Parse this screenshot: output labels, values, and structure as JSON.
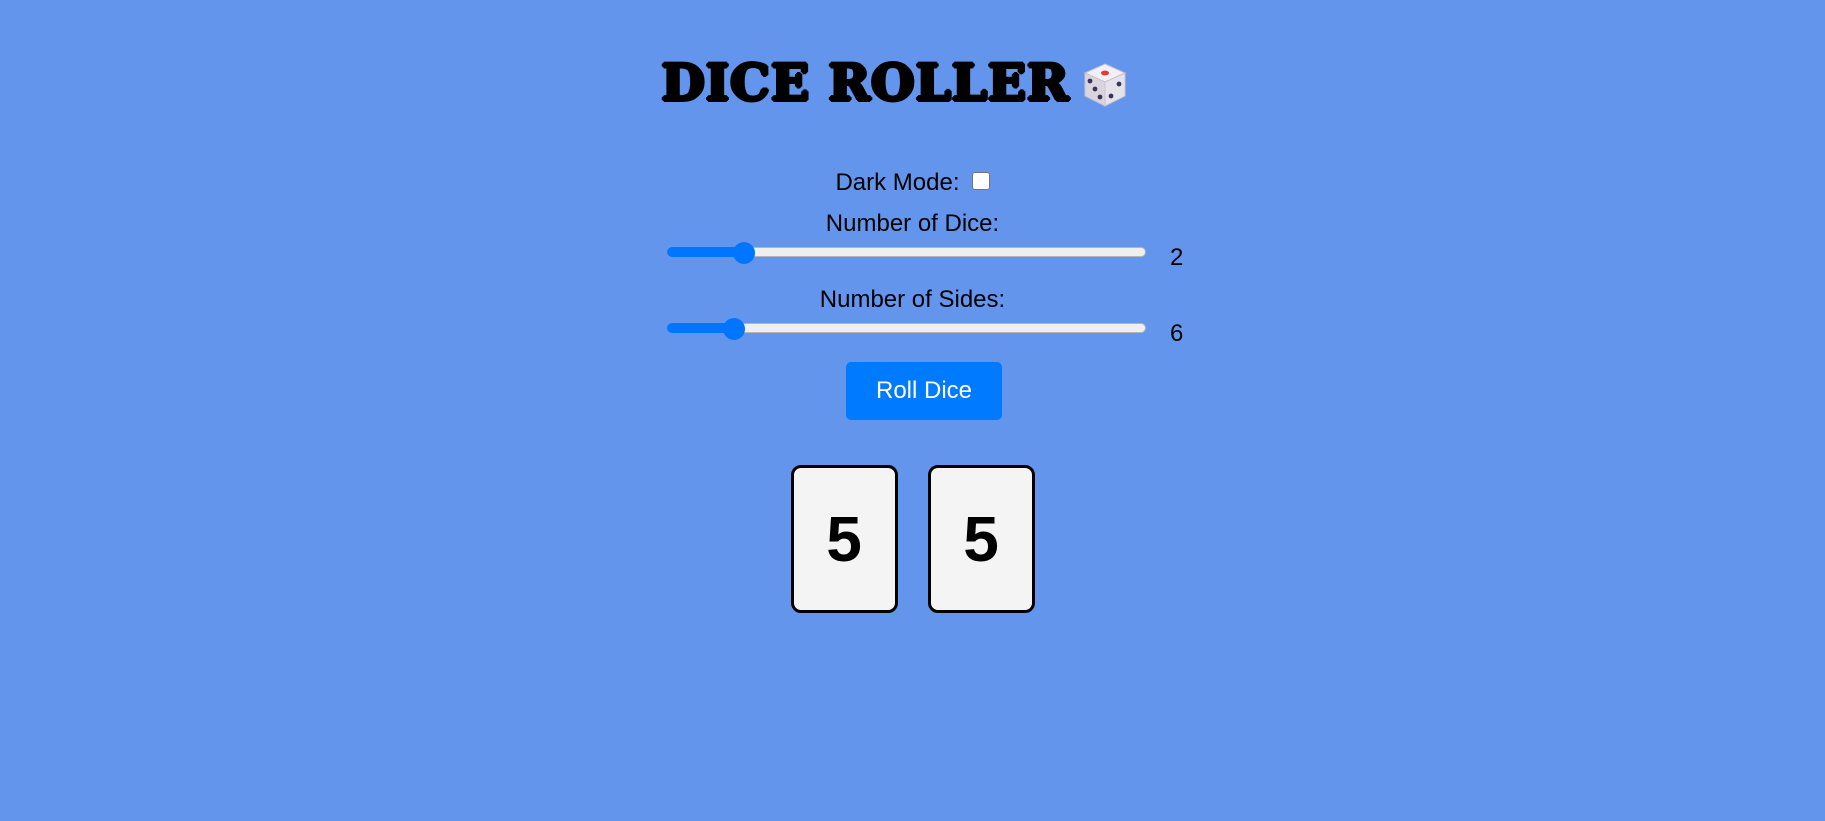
{
  "header": {
    "title": "DICE ROLLER",
    "title_icon": "game-die-icon"
  },
  "controls": {
    "dark_mode_label": "Dark Mode:",
    "dark_mode_checked": false,
    "dice_count_label": "Number of Dice:",
    "dice_count_value": "2",
    "sides_label": "Number of Sides:",
    "sides_value": "6"
  },
  "roll_button_label": "Roll Dice",
  "results": [
    "5",
    "5"
  ],
  "colors": {
    "background": "#6495ed",
    "accent": "#0075ff",
    "button": "#007bff",
    "die_face": "#f4f4f4"
  }
}
